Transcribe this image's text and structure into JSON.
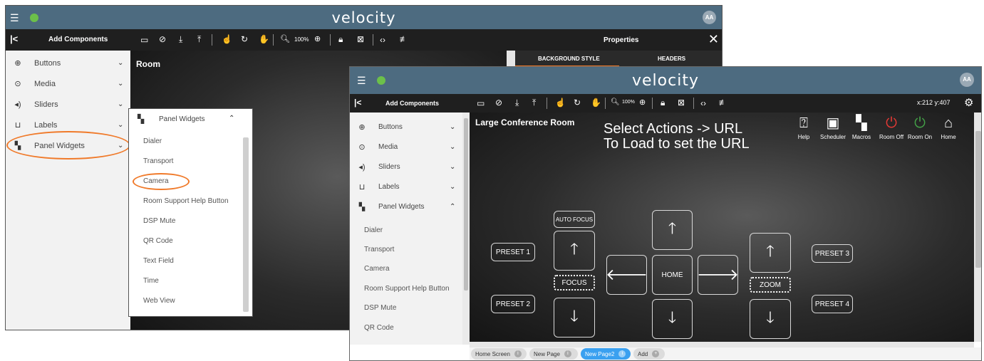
{
  "app": {
    "logo": "velocity",
    "avatar": "AA"
  },
  "back_window": {
    "sidebar_title": "Add Components",
    "sidebar_items": [
      {
        "icon": "plus-circle",
        "label": "Buttons"
      },
      {
        "icon": "play-circle",
        "label": "Media"
      },
      {
        "icon": "speaker",
        "label": "Sliders"
      },
      {
        "icon": "label-bracket",
        "label": "Labels"
      },
      {
        "icon": "dashboard-grid",
        "label": "Panel Widgets"
      }
    ],
    "zoom": "100%",
    "room_title": "Room",
    "properties": {
      "title": "Properties",
      "tabs": [
        "BACKGROUND STYLE",
        "HEADERS"
      ]
    }
  },
  "popup": {
    "title": "Panel Widgets",
    "items": [
      "Dialer",
      "Transport",
      "Camera",
      "Room Support Help Button",
      "DSP Mute",
      "QR Code",
      "Text Field",
      "Time",
      "Web View"
    ]
  },
  "front_window": {
    "sidebar_title": "Add Components",
    "sidebar_items": [
      {
        "icon": "plus-circle",
        "label": "Buttons"
      },
      {
        "icon": "play-circle",
        "label": "Media"
      },
      {
        "icon": "speaker",
        "label": "Sliders"
      },
      {
        "icon": "label-bracket",
        "label": "Labels"
      },
      {
        "icon": "dashboard-grid",
        "label": "Panel Widgets"
      }
    ],
    "panel_widgets": [
      "Dialer",
      "Transport",
      "Camera",
      "Room Support Help Button",
      "DSP Mute",
      "QR Code"
    ],
    "zoom": "100%",
    "coords": "x:212 y:407",
    "room_title": "Large Conference Room",
    "instruction_line1": "Select Actions -> URL",
    "instruction_line2": "To Load to set the URL",
    "top_icons": [
      {
        "icon": "help-circle",
        "label": "Help",
        "color": "#ffffff"
      },
      {
        "icon": "scheduler",
        "label": "Scheduler",
        "color": "#ffffff"
      },
      {
        "icon": "macros",
        "label": "Macros",
        "color": "#ffffff"
      },
      {
        "icon": "power",
        "label": "Room Off",
        "color": "#e53935"
      },
      {
        "icon": "power",
        "label": "Room On",
        "color": "#43a047"
      },
      {
        "icon": "home",
        "label": "Home",
        "color": "#ffffff"
      }
    ],
    "camera": {
      "auto_focus": "AUTO FOCUS",
      "focus": "FOCUS",
      "home": "HOME",
      "zoom": "ZOOM",
      "preset1": "PRESET 1",
      "preset2": "PRESET 2",
      "preset3": "PRESET 3",
      "preset4": "PRESET 4"
    },
    "page_tabs": [
      "Home Screen",
      "New Page",
      "New Page2",
      "Add"
    ]
  },
  "colors": {
    "titlebar": "#4d6b80",
    "toolbar": "#1f1f1f",
    "accent_orange": "#f07a2a",
    "tab_active": "#3aa0f0"
  }
}
